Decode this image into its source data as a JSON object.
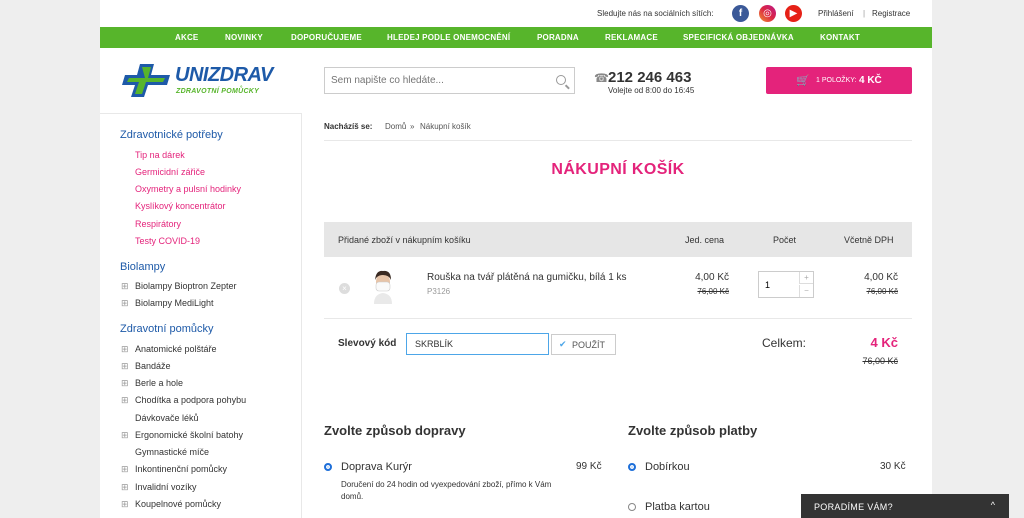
{
  "topbar": {
    "follow_text": "Sledujte nás na sociálních sítích:",
    "login": "Přihlášení",
    "separator": "|",
    "register": "Registrace"
  },
  "nav": [
    {
      "label": "AKCE"
    },
    {
      "label": "NOVINKY"
    },
    {
      "label": "DOPORUČUJEME"
    },
    {
      "label": "HLEDEJ PODLE ONEMOCNĚNÍ"
    },
    {
      "label": "PORADNA"
    },
    {
      "label": "REKLAMACE"
    },
    {
      "label": "SPECIFICKÁ OBJEDNÁVKA"
    },
    {
      "label": "KONTAKT"
    }
  ],
  "logo": {
    "brand": "UNIZDRAV",
    "tagline": "ZDRAVOTNÍ POMŮCKY"
  },
  "search": {
    "placeholder": "Sem napište co hledáte..."
  },
  "contact": {
    "phone": "212 246 463",
    "hours": "Volejte od 8:00 do 16:45"
  },
  "cart": {
    "items_label": "1 POLOŽKY:",
    "price": "4 KČ"
  },
  "sidebar": {
    "cat1": "Zdravotnické potřeby",
    "cat1_items": [
      "Tip na dárek",
      "Germicidní zářiče",
      "Oxymetry a pulsní hodinky",
      "Kyslíkový koncentrátor",
      "Respirátory",
      "Testy COVID-19"
    ],
    "cat2": "Biolampy",
    "cat2_items": [
      "Biolampy Bioptron Zepter",
      "Biolampy MediLight"
    ],
    "cat3": "Zdravotní pomůcky",
    "cat3_items": [
      "Anatomické polštáře",
      "Bandáže",
      "Berle a hole",
      "Chodítka a podpora pohybu",
      "Dávkovače léků",
      "Ergonomické školní batohy",
      "Gymnastické míče",
      "Inkontinenční pomůcky",
      "Invalidní vozíky",
      "Koupelnové pomůcky"
    ]
  },
  "breadcrumb": {
    "label": "Nacházíš se:",
    "home": "Domů",
    "sep": "»",
    "current": "Nákupní košík"
  },
  "page_title": "NÁKUPNÍ KOŠÍK",
  "table": {
    "headers": {
      "product": "Přidané zboží v nákupním košíku",
      "unit_price": "Jed. cena",
      "qty": "Počet",
      "total": "Včetně DPH"
    },
    "rows": [
      {
        "name": "Rouška na tvář plátěná na gumičku, bílá 1 ks",
        "code": "P3126",
        "unit_price": "4,00 Kč",
        "unit_old": "76,00 Kč",
        "qty": "1",
        "total": "4,00 Kč",
        "total_old": "76,00 Kč"
      }
    ]
  },
  "discount": {
    "label": "Slevový kód",
    "value": "SKRBLÍK",
    "apply": "POUŽÍT"
  },
  "summary": {
    "label": "Celkem:",
    "total": "4 Kč",
    "old": "76,00 Kč"
  },
  "shipping": {
    "title": "Zvolte způsob dopravy",
    "options": [
      {
        "label": "Doprava Kurýr",
        "price": "99 Kč",
        "desc": "Doručení do 24 hodin od vyexpedování zboží, přímo k Vám domů.",
        "selected": true
      }
    ]
  },
  "payment": {
    "title": "Zvolte způsob platby",
    "options": [
      {
        "label": "Dobírkou",
        "price": "30 Kč",
        "selected": true
      },
      {
        "label": "Platba kartou",
        "selected": false
      }
    ]
  },
  "help": {
    "label": "PORADÍME VÁM?",
    "chevron": "^"
  },
  "icons": {
    "remove": "×",
    "phone": "☎",
    "cart": "🛒",
    "up": "+",
    "down": "−",
    "check": "✔"
  },
  "colors": {
    "accent": "#e4237b",
    "nav": "#57b52b",
    "brand": "#1e5aa8"
  }
}
